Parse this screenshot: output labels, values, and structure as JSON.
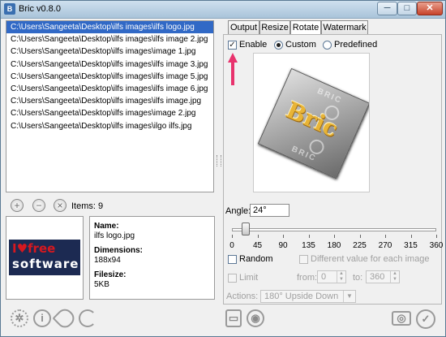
{
  "window": {
    "title": "Bric v0.8.0",
    "icon": "bric-app-icon",
    "min_label": "─",
    "max_label": "□",
    "close_label": "✕"
  },
  "files": [
    "C:\\Users\\Sangeeta\\Desktop\\ilfs images\\ilfs logo.jpg",
    "C:\\Users\\Sangeeta\\Desktop\\ilfs images\\ilfs image 2.jpg",
    "C:\\Users\\Sangeeta\\Desktop\\ilfs images\\image 1.jpg",
    "C:\\Users\\Sangeeta\\Desktop\\ilfs images\\ilfs image 3.jpg",
    "C:\\Users\\Sangeeta\\Desktop\\ilfs images\\ilfs image 5.jpg",
    "C:\\Users\\Sangeeta\\Desktop\\ilfs images\\ilfs image 6.jpg",
    "C:\\Users\\Sangeeta\\Desktop\\ilfs images\\ilfs image.jpg",
    "C:\\Users\\Sangeeta\\Desktop\\ilfs images\\image 2.jpg",
    "C:\\Users\\Sangeeta\\Desktop\\ilfs images\\ilgo ilfs.jpg"
  ],
  "items_label": "Items: 9",
  "thumbnail": {
    "line1": "I♥free",
    "line2": "software"
  },
  "info": {
    "name_label": "Name:",
    "name_value": "ilfs logo.jpg",
    "dim_label": "Dimensions:",
    "dim_value": "188x94",
    "size_label": "Filesize:",
    "size_value": "5KB"
  },
  "tabs": [
    "Output",
    "Resize",
    "Rotate",
    "Watermark"
  ],
  "active_tab": "Rotate",
  "rotate": {
    "enable_label": "Enable",
    "custom_label": "Custom",
    "predefined_label": "Predefined",
    "preview_text": "Bric",
    "watermark_text": "BRIC",
    "angle_label": "Angle:",
    "angle_value": "24°",
    "slider_ticks": [
      "0",
      "45",
      "90",
      "135",
      "180",
      "225",
      "270",
      "315",
      "360"
    ],
    "slider_value": 24,
    "random_label": "Random",
    "different_label": "Different value for each image",
    "limit_label": "Limit",
    "from_label": "from:",
    "from_value": "0",
    "to_label": "to:",
    "to_value": "360",
    "actions_label": "Actions:",
    "actions_value": "180° Upside Down"
  },
  "colors": {
    "selection": "#3169c6",
    "accent_arrow": "#e8336d"
  }
}
